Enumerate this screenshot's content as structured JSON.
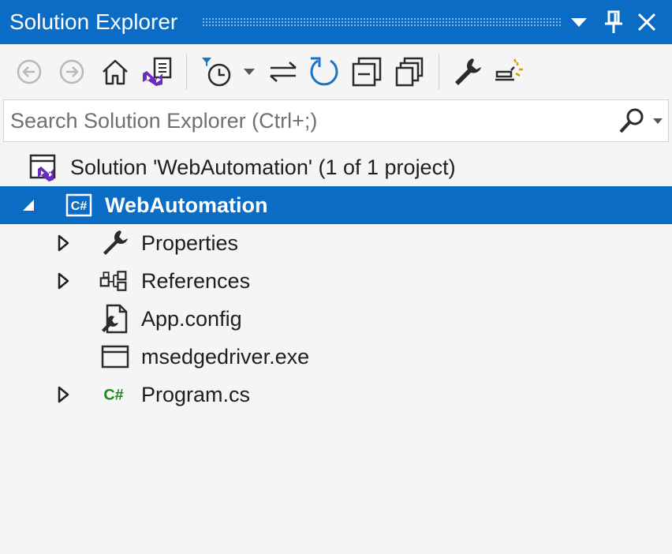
{
  "window": {
    "title": "Solution Explorer",
    "colors": {
      "title_bg": "#0a6cc4",
      "selection_bg": "#0a6cc4",
      "csharp_green": "#1b8a1b",
      "vs_purple": "#6a2bbf",
      "accent_blue": "#1a73c8"
    }
  },
  "title_buttons": [
    {
      "icon": "dropdown-arrow-icon"
    },
    {
      "icon": "pin-icon"
    },
    {
      "icon": "close-icon"
    }
  ],
  "toolbar": {
    "items": [
      {
        "icon": "back-arrow-icon",
        "enabled": false
      },
      {
        "icon": "forward-arrow-icon",
        "enabled": false
      },
      {
        "icon": "home-icon",
        "enabled": true
      },
      {
        "icon": "switch-views-icon",
        "enabled": true
      },
      {
        "icon": "pending-changes-filter-icon",
        "enabled": true
      },
      {
        "icon": "filter-dropdown-icon",
        "enabled": true
      },
      {
        "icon": "sync-with-active-document-icon",
        "enabled": true
      },
      {
        "icon": "refresh-icon",
        "enabled": true
      },
      {
        "icon": "collapse-all-icon",
        "enabled": true
      },
      {
        "icon": "show-all-files-icon",
        "enabled": true
      },
      {
        "icon": "properties-wrench-icon",
        "enabled": true
      },
      {
        "icon": "preview-selected-items-icon",
        "enabled": true
      }
    ]
  },
  "search": {
    "placeholder": "Search Solution Explorer (Ctrl+;)",
    "value": ""
  },
  "tree": {
    "solution": {
      "label": "Solution 'WebAutomation' (1 of 1 project)",
      "icon": "solution-icon"
    },
    "project": {
      "label": "WebAutomation",
      "icon": "csharp-project-icon",
      "expanded": true,
      "selected": true
    },
    "items": [
      {
        "label": "Properties",
        "icon": "wrench-icon",
        "expandable": true
      },
      {
        "label": "References",
        "icon": "references-icon",
        "expandable": true
      },
      {
        "label": "App.config",
        "icon": "config-file-icon",
        "expandable": false
      },
      {
        "label": "msedgedriver.exe",
        "icon": "exe-file-icon",
        "expandable": false
      },
      {
        "label": "Program.cs",
        "icon": "csharp-file-icon",
        "expandable": true
      }
    ]
  }
}
